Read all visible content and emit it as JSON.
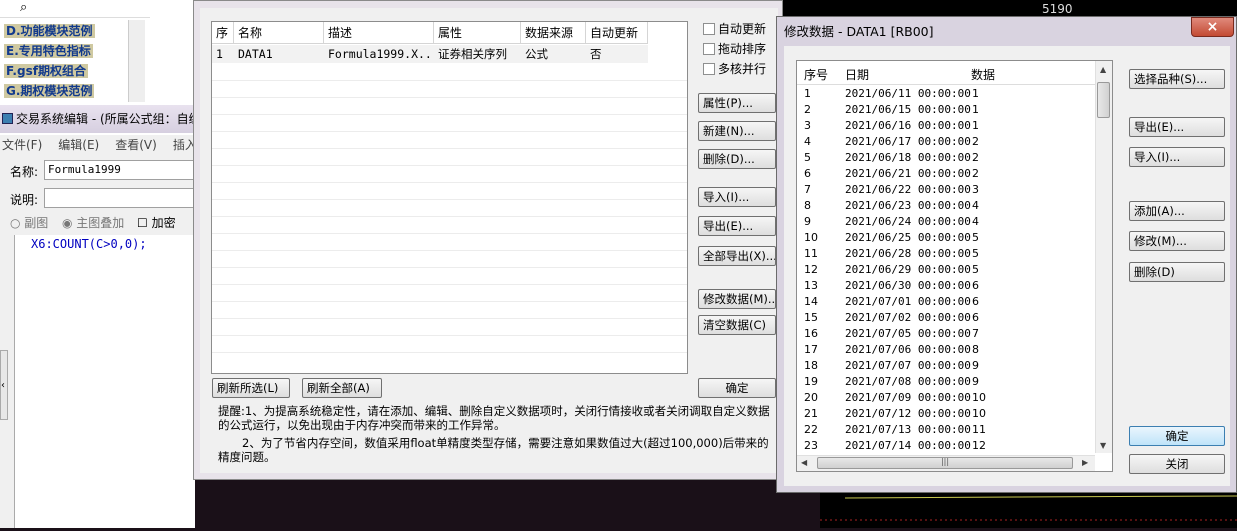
{
  "left_tree": {
    "items": [
      "D.功能模块范例",
      "E.专用特色指标",
      "F.gsf期权组合",
      "G.期权模块范例"
    ]
  },
  "editor": {
    "title": "交易系统编辑 - (所属公式组：自编",
    "menu": [
      "文件(F)",
      "编辑(E)",
      "查看(V)",
      "插入(I"
    ],
    "name_label": "名称:",
    "name_value": "Formula1999",
    "desc_label": "说明:",
    "radio_sub": "副图",
    "radio_main": "主图叠加",
    "check_encrypt": "加密",
    "code": "X6:COUNT(C>0,0);"
  },
  "main_dialog": {
    "columns": [
      "序",
      "名称",
      "描述",
      "属性",
      "数据来源",
      "自动更新"
    ],
    "rows": [
      {
        "idx": "1",
        "name": "DATA1",
        "desc": "Formula1999.X...",
        "attr": "证券相关序列",
        "source": "公式",
        "auto": "否"
      }
    ],
    "checks": [
      "自动更新",
      "拖动排序",
      "多核并行"
    ],
    "buttons": {
      "props": "属性(P)...",
      "new": "新建(N)...",
      "delete": "删除(D)...",
      "import": "导入(I)...",
      "export": "导出(E)...",
      "export_all": "全部导出(X)...",
      "modify": "修改数据(M)...",
      "clear": "清空数据(C)",
      "ok": "确定",
      "refresh_sel": "刷新所选(L)",
      "refresh_all": "刷新全部(A)"
    },
    "tip1": "提醒:1、为提高系统稳定性，请在添加、编辑、删除自定义数据项时，关闭行情接收或者关闭调取自定义数据的公式运行，以免出现由于内存冲突而带来的工作异常。",
    "tip2": "2、为了节省内存空间，数值采用float单精度类型存储，需要注意如果数值过大(超过100,000)后带来的精度问题。"
  },
  "modify_dialog": {
    "title": "修改数据 - DATA1 [RB00]",
    "close": "×",
    "columns": [
      "序号",
      "日期",
      "数据"
    ],
    "rows": [
      [
        "1",
        "2021/06/11  00:00:00",
        "1"
      ],
      [
        "2",
        "2021/06/15  00:00:00",
        "1"
      ],
      [
        "3",
        "2021/06/16  00:00:00",
        "1"
      ],
      [
        "4",
        "2021/06/17  00:00:00",
        "2"
      ],
      [
        "5",
        "2021/06/18  00:00:00",
        "2"
      ],
      [
        "6",
        "2021/06/21  00:00:00",
        "2"
      ],
      [
        "7",
        "2021/06/22  00:00:00",
        "3"
      ],
      [
        "8",
        "2021/06/23  00:00:00",
        "4"
      ],
      [
        "9",
        "2021/06/24  00:00:00",
        "4"
      ],
      [
        "10",
        "2021/06/25  00:00:00",
        "5"
      ],
      [
        "11",
        "2021/06/28  00:00:00",
        "5"
      ],
      [
        "12",
        "2021/06/29  00:00:00",
        "5"
      ],
      [
        "13",
        "2021/06/30  00:00:00",
        "6"
      ],
      [
        "14",
        "2021/07/01  00:00:00",
        "6"
      ],
      [
        "15",
        "2021/07/02  00:00:00",
        "6"
      ],
      [
        "16",
        "2021/07/05  00:00:00",
        "7"
      ],
      [
        "17",
        "2021/07/06  00:00:00",
        "8"
      ],
      [
        "18",
        "2021/07/07  00:00:00",
        "9"
      ],
      [
        "19",
        "2021/07/08  00:00:00",
        "9"
      ],
      [
        "20",
        "2021/07/09  00:00:00",
        "10"
      ],
      [
        "21",
        "2021/07/12  00:00:00",
        "10"
      ],
      [
        "22",
        "2021/07/13  00:00:00",
        "11"
      ],
      [
        "23",
        "2021/07/14  00:00:00",
        "12"
      ]
    ],
    "buttons": {
      "select": "选择品种(S)...",
      "export": "导出(E)...",
      "import": "导入(I)...",
      "add": "添加(A)...",
      "modify": "修改(M)...",
      "delete": "删除(D)",
      "ok": "确定",
      "close": "关闭"
    }
  },
  "background_chart": {
    "price_label": "5190"
  }
}
